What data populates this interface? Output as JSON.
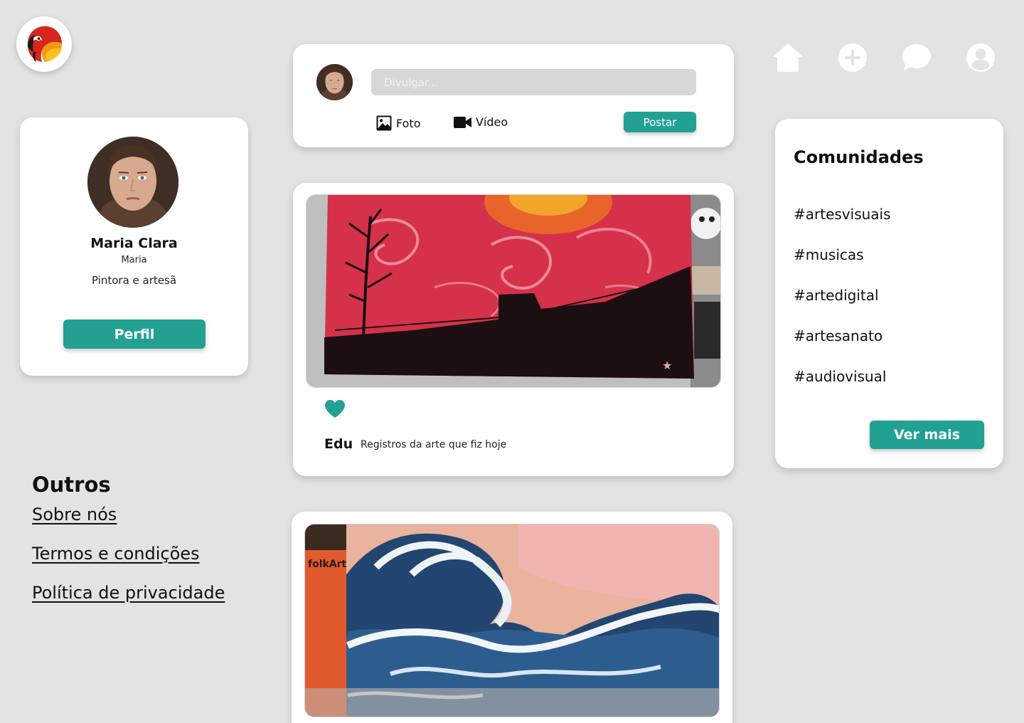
{
  "brand": {
    "logo_icon": "parrot-logo-icon"
  },
  "profile": {
    "name": "Maria Clara",
    "username": "Maria",
    "bio": "Pintora e artesã",
    "button_label": "Perfil"
  },
  "outros": {
    "title": "Outros",
    "links": [
      "Sobre nós",
      "Termos e condições",
      "Política de privacidade"
    ]
  },
  "composer": {
    "placeholder": "Divulgar...",
    "photo_label": "Foto",
    "video_label": "Vídeo",
    "post_button": "Postar"
  },
  "posts": [
    {
      "author": "Edu",
      "caption": "Registros da arte que fiz hoje",
      "image": "painting-red-sky-silhouette",
      "liked": true
    },
    {
      "author": "",
      "caption": "",
      "image": "painting-ocean-wave",
      "liked": false
    }
  ],
  "nav": {
    "icons": [
      "home-icon",
      "plus-circle-icon",
      "chat-icon",
      "user-circle-icon"
    ]
  },
  "communities": {
    "title": "Comunidades",
    "items": [
      "#artesvisuais",
      "#musicas",
      "#artedigital",
      "#artesanato",
      "#audiovisual"
    ],
    "more_button": "Ver mais"
  },
  "colors": {
    "accent": "#22a193",
    "background": "#e3e3e3",
    "card": "#ffffff"
  }
}
